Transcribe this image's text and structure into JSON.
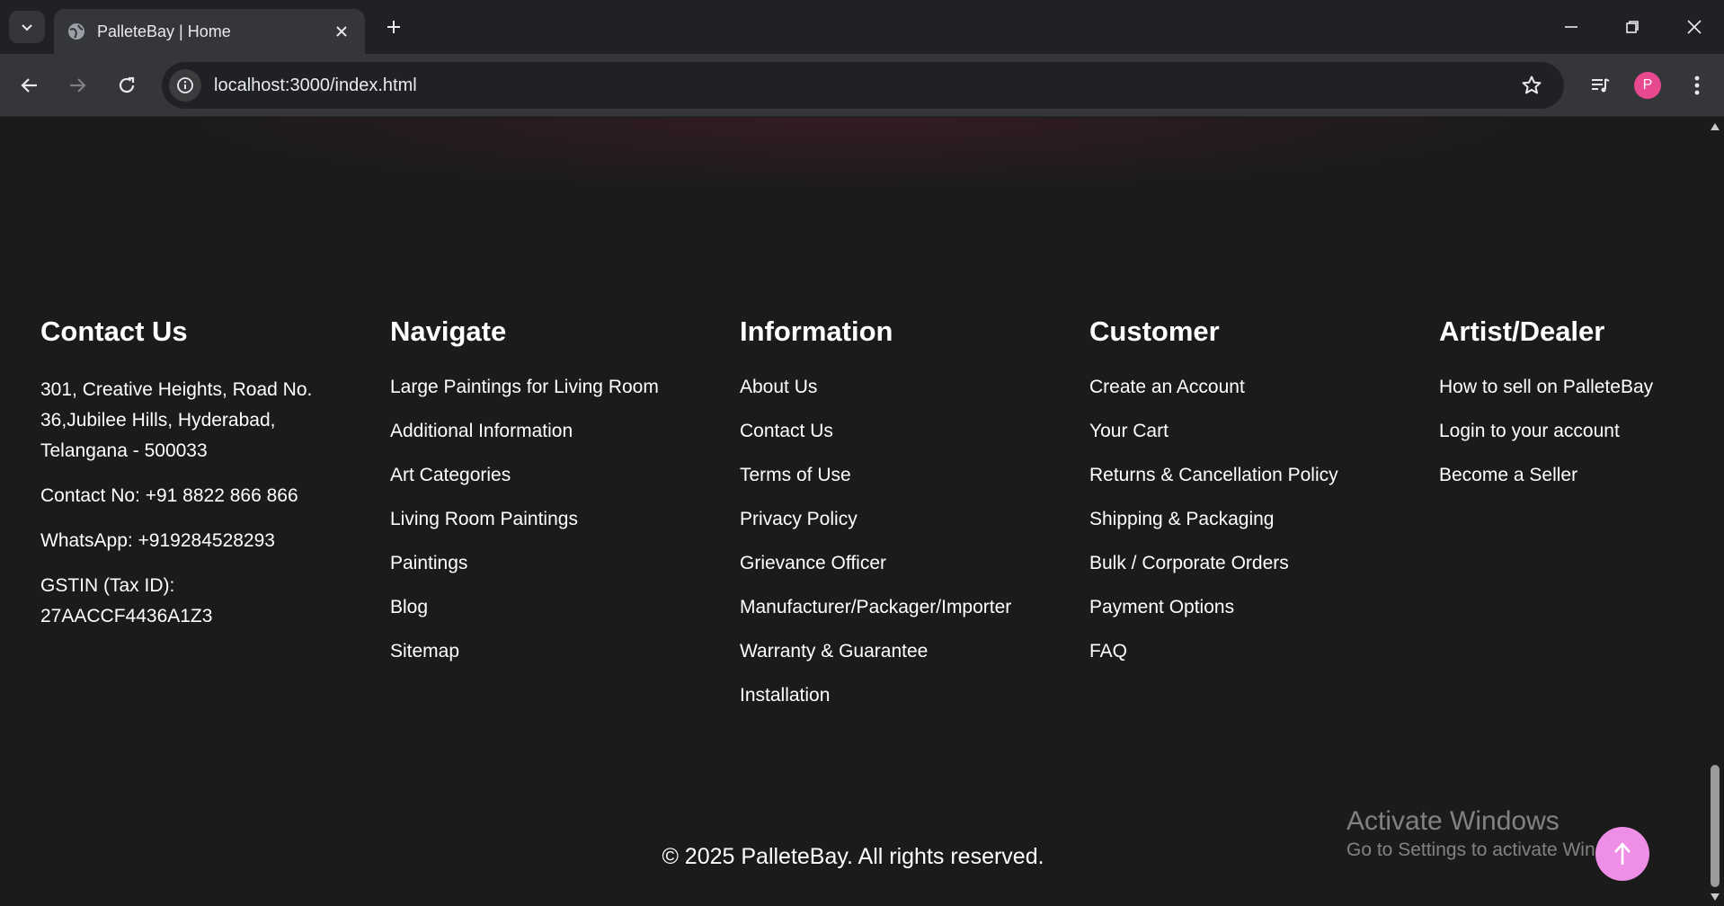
{
  "browser": {
    "tab_title": "PalleteBay | Home",
    "url": "localhost:3000/index.html",
    "profile_initial": "P",
    "profile_color": "#e8488e"
  },
  "footer": {
    "contact": {
      "heading": "Contact Us",
      "address": "301, Creative Heights, Road No. 36,Jubilee Hills, Hyderabad, Telangana - 500033",
      "phone": "Contact No: +91 8822 866 866",
      "whatsapp": "WhatsApp: +919284528293",
      "gstin": "GSTIN (Tax ID): 27AACCF4436A1Z3"
    },
    "navigate": {
      "heading": "Navigate",
      "links": [
        "Large Paintings for Living Room",
        "Additional Information",
        "Art Categories",
        "Living Room Paintings",
        "Paintings",
        "Blog",
        "Sitemap"
      ]
    },
    "information": {
      "heading": "Information",
      "links": [
        "About Us",
        "Contact Us",
        "Terms of Use",
        "Privacy Policy",
        "Grievance Officer",
        "Manufacturer/Packager/Importer",
        "Warranty & Guarantee",
        "Installation"
      ]
    },
    "customer": {
      "heading": "Customer",
      "links": [
        "Create an Account",
        "Your Cart",
        "Returns & Cancellation Policy",
        "Shipping & Packaging",
        "Bulk / Corporate Orders",
        "Payment Options",
        "FAQ"
      ]
    },
    "artist": {
      "heading": "Artist/Dealer",
      "links": [
        "How to sell on PalleteBay",
        "Login to your account",
        "Become a Seller"
      ]
    },
    "copyright": "© 2025 PalleteBay. All rights reserved."
  },
  "watermark": {
    "title": "Activate Windows",
    "subtitle": "Go to Settings to activate Windows."
  },
  "colors": {
    "page_bg": "#1c1b1c",
    "back_to_top": "#ee8ee6"
  },
  "icons": {
    "back_to_top": "arrow-up-icon"
  }
}
